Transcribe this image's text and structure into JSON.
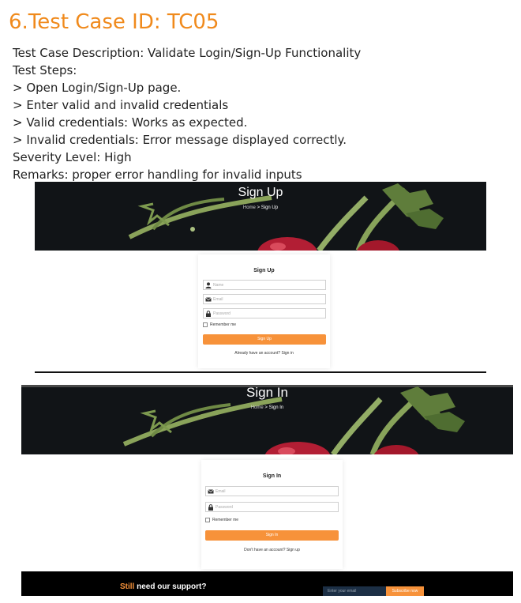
{
  "test_case": {
    "title": "6.Test Case ID: TC05",
    "description": "Test Case Description: Validate Login/Sign-Up Functionality",
    "steps_label": "Test Steps:",
    "steps": [
      "> Open Login/Sign-Up page.",
      "> Enter valid and invalid credentials",
      "> Valid credentials: Works as expected.",
      "> Invalid credentials: Error message displayed correctly."
    ],
    "severity": "Severity Level: High",
    "remarks": "Remarks: proper error handling for invalid inputs"
  },
  "signup": {
    "banner_title": "Sign Up",
    "crumb_home": "Home",
    "crumb_sep": ">",
    "crumb_current": "Sign Up",
    "form_title": "Sign Up",
    "name_placeholder": "Name",
    "email_placeholder": "Email",
    "password_placeholder": "Password",
    "remember": "Remember me",
    "button": "Sign Up",
    "alt_link": "Already have an account? Sign in"
  },
  "signin": {
    "banner_title": "Sign In",
    "crumb_home": "Home",
    "crumb_sep": ">",
    "crumb_current": "Sign In",
    "form_title": "Sign In",
    "email_placeholder": "Email",
    "password_placeholder": "Password",
    "remember": "Remember me",
    "button": "Sign In",
    "alt_link": "Don't have an account? Sign up"
  },
  "footer": {
    "highlight": "Still",
    "question": " need our support?",
    "email_placeholder": "Enter your email",
    "subscribe": "Subscribe now"
  },
  "colors": {
    "title": "#f08a1c",
    "accent": "#f7923a",
    "banner_bg": "#0f1215",
    "footer_bg": "#000000"
  },
  "icons": [
    "user-icon",
    "envelope-icon",
    "lock-icon"
  ]
}
